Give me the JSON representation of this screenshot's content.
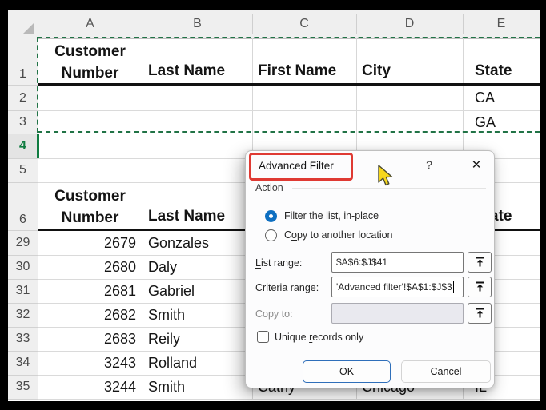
{
  "grid": {
    "column_headers": [
      "A",
      "B",
      "C",
      "D",
      "E"
    ],
    "row_headers": [
      "1",
      "2",
      "3",
      "4",
      "5",
      "6",
      "29",
      "30",
      "31",
      "32",
      "33",
      "34",
      "35"
    ],
    "headers": {
      "customer_line1": "Customer",
      "customer_line2": "Number",
      "last_name": "Last Name",
      "first_name": "First Name",
      "city": "City",
      "state": "State"
    },
    "criteria_values": {
      "row2_state": "CA",
      "row3_state": "GA"
    },
    "rows": [
      {
        "row": "29",
        "customer_number": "2679",
        "last_name": "Gonzales"
      },
      {
        "row": "30",
        "customer_number": "2680",
        "last_name": "Daly"
      },
      {
        "row": "31",
        "customer_number": "2681",
        "last_name": "Gabriel"
      },
      {
        "row": "32",
        "customer_number": "2682",
        "last_name": "Smith"
      },
      {
        "row": "33",
        "customer_number": "2683",
        "last_name": "Reily"
      },
      {
        "row": "34",
        "customer_number": "3243",
        "last_name": "Rolland"
      },
      {
        "row": "35",
        "customer_number": "3244",
        "last_name": "Smith",
        "first_name": "Cathy",
        "city": "Chicago",
        "state": "IL"
      }
    ]
  },
  "dialog": {
    "title": "Advanced Filter",
    "help": "?",
    "close": "✕",
    "action_label": "Action",
    "radio_filter": {
      "u": "F",
      "rest": "ilter the list, in-place",
      "selected": "true"
    },
    "radio_copy": {
      "pre": "C",
      "u": "o",
      "rest": "py to another location",
      "selected": "false"
    },
    "list_range": {
      "label_u": "L",
      "label_rest": "ist range:",
      "value": "$A$6:$J$41"
    },
    "criteria_range": {
      "label_u": "C",
      "label_rest": "riteria range:",
      "value": "'Advanced filter'!$A$1:$J$3"
    },
    "copy_to": {
      "label": "Copy to:",
      "value": ""
    },
    "unique_checkbox": {
      "pre": "Unique ",
      "u": "r",
      "rest": "ecords only",
      "checked": "false"
    },
    "ok": "OK",
    "cancel": "Cancel"
  },
  "colors": {
    "selection_green": "#217346",
    "active_green": "#107C41",
    "radio_blue": "#0e6fc1",
    "ok_border_blue": "#2f6fba",
    "annotation_red": "#df3a33"
  }
}
